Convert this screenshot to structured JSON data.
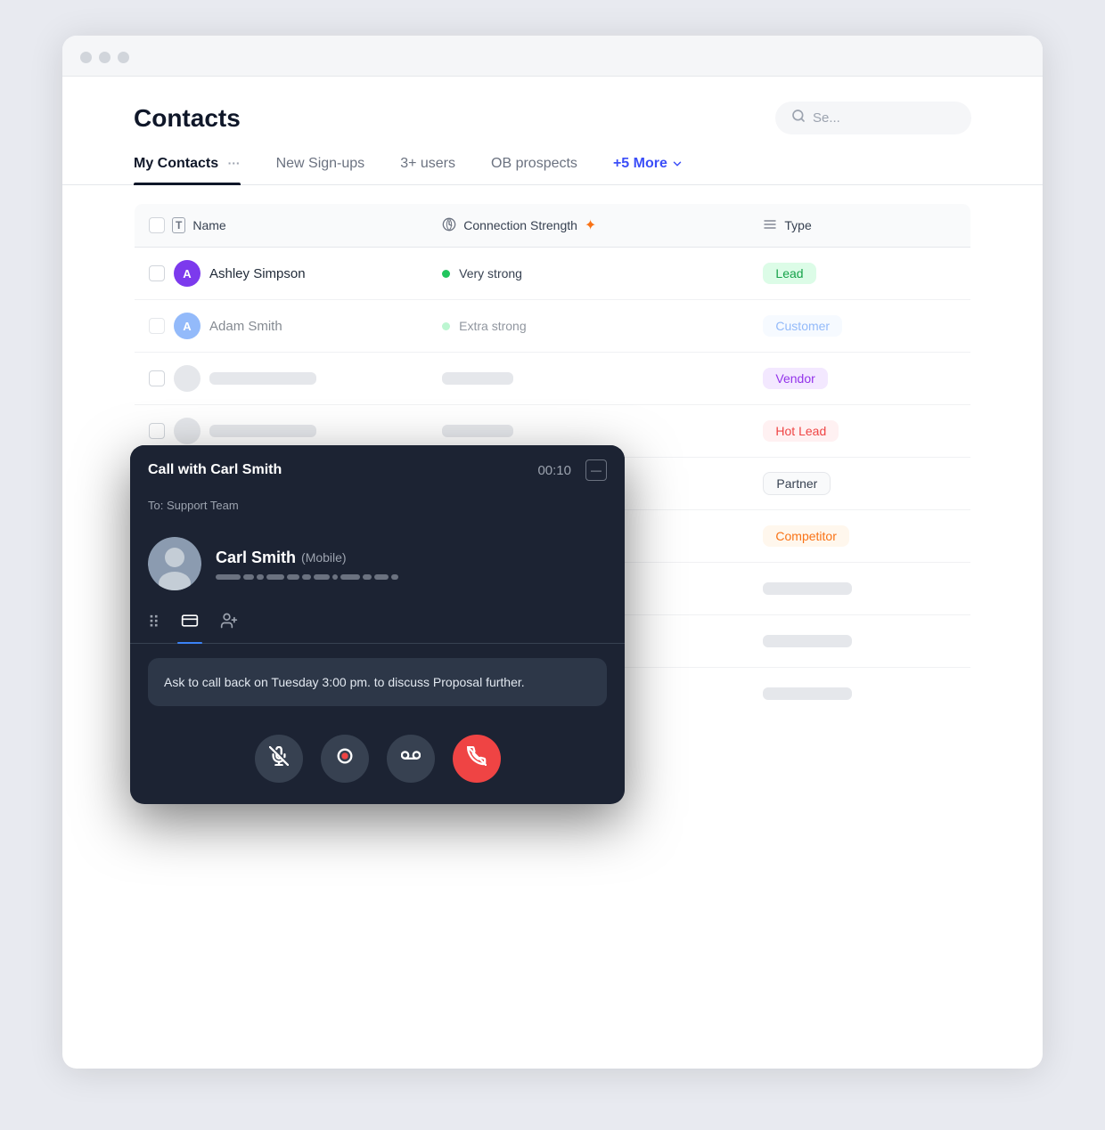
{
  "browser": {
    "dots": [
      "dot1",
      "dot2",
      "dot3"
    ]
  },
  "header": {
    "title": "Contacts",
    "search_placeholder": "Se..."
  },
  "tabs": [
    {
      "label": "My Contacts",
      "active": true,
      "dots": "···"
    },
    {
      "label": "New Sign-ups",
      "active": false
    },
    {
      "label": "3+ users",
      "active": false
    },
    {
      "label": "OB prospects",
      "active": false
    },
    {
      "label": "+5 More",
      "active": false,
      "more": true
    }
  ],
  "table": {
    "headers": {
      "name": "Name",
      "connection_strength": "Connection Strength",
      "type": "Type"
    },
    "rows": [
      {
        "avatar_letter": "A",
        "avatar_color": "purple",
        "name": "Ashley Simpson",
        "strength_label": "Very strong",
        "strength_dot": "green",
        "type_label": "Lead",
        "type_badge": "lead"
      },
      {
        "avatar_letter": "A",
        "avatar_color": "blue",
        "name": "Adam Smith",
        "strength_label": "Extra strong",
        "strength_dot": "light-green",
        "type_label": "Customer",
        "type_badge": "customer"
      },
      {
        "avatar_letter": "",
        "avatar_color": "",
        "name": "",
        "strength_label": "",
        "strength_dot": "",
        "type_label": "Vendor",
        "type_badge": "vendor"
      },
      {
        "avatar_letter": "",
        "avatar_color": "",
        "name": "",
        "strength_label": "",
        "strength_dot": "",
        "type_label": "Hot Lead",
        "type_badge": "hot-lead"
      },
      {
        "avatar_letter": "",
        "avatar_color": "",
        "name": "",
        "strength_label": "",
        "strength_dot": "",
        "type_label": "Partner",
        "type_badge": "partner"
      },
      {
        "avatar_letter": "",
        "avatar_color": "",
        "name": "",
        "strength_label": "",
        "strength_dot": "",
        "type_label": "Competitor",
        "type_badge": "competitor"
      },
      {
        "avatar_letter": "",
        "avatar_color": "",
        "name": "",
        "strength_label": "",
        "strength_dot": "",
        "type_label": "",
        "type_badge": "skeleton"
      },
      {
        "avatar_letter": "",
        "avatar_color": "",
        "name": "",
        "strength_label": "",
        "strength_dot": "",
        "type_label": "",
        "type_badge": "skeleton"
      },
      {
        "avatar_letter": "",
        "avatar_color": "",
        "name": "",
        "strength_label": "",
        "strength_dot": "",
        "type_label": "",
        "type_badge": "skeleton"
      }
    ]
  },
  "call_overlay": {
    "title": "Call with Carl Smith",
    "timer": "00:10",
    "to_label": "To: Support Team",
    "person_name": "Carl Smith",
    "person_sub": "(Mobile)",
    "note": "Ask to call back on Tuesday 3:00 pm. to discuss Proposal further.",
    "minimize_icon": "—",
    "tabs": [
      "keypad",
      "card",
      "transfer"
    ],
    "actions": [
      "mute",
      "record",
      "voicemail",
      "hangup"
    ]
  },
  "colors": {
    "active_tab_underline": "#0f1729",
    "more_tab": "#3b4ef8",
    "badge_lead_bg": "#dcfce7",
    "badge_lead_text": "#16a34a",
    "badge_customer_bg": "#eff6ff",
    "badge_customer_text": "#3b82f6",
    "badge_vendor_bg": "#f3e8ff",
    "badge_vendor_text": "#9333ea",
    "badge_hot_lead_bg": "#fff1f2",
    "badge_hot_lead_text": "#ef4444",
    "badge_competitor_bg": "#fff7ed",
    "badge_competitor_text": "#f97316",
    "accent_blue": "#3b82f6",
    "hangup_red": "#ef4444"
  }
}
